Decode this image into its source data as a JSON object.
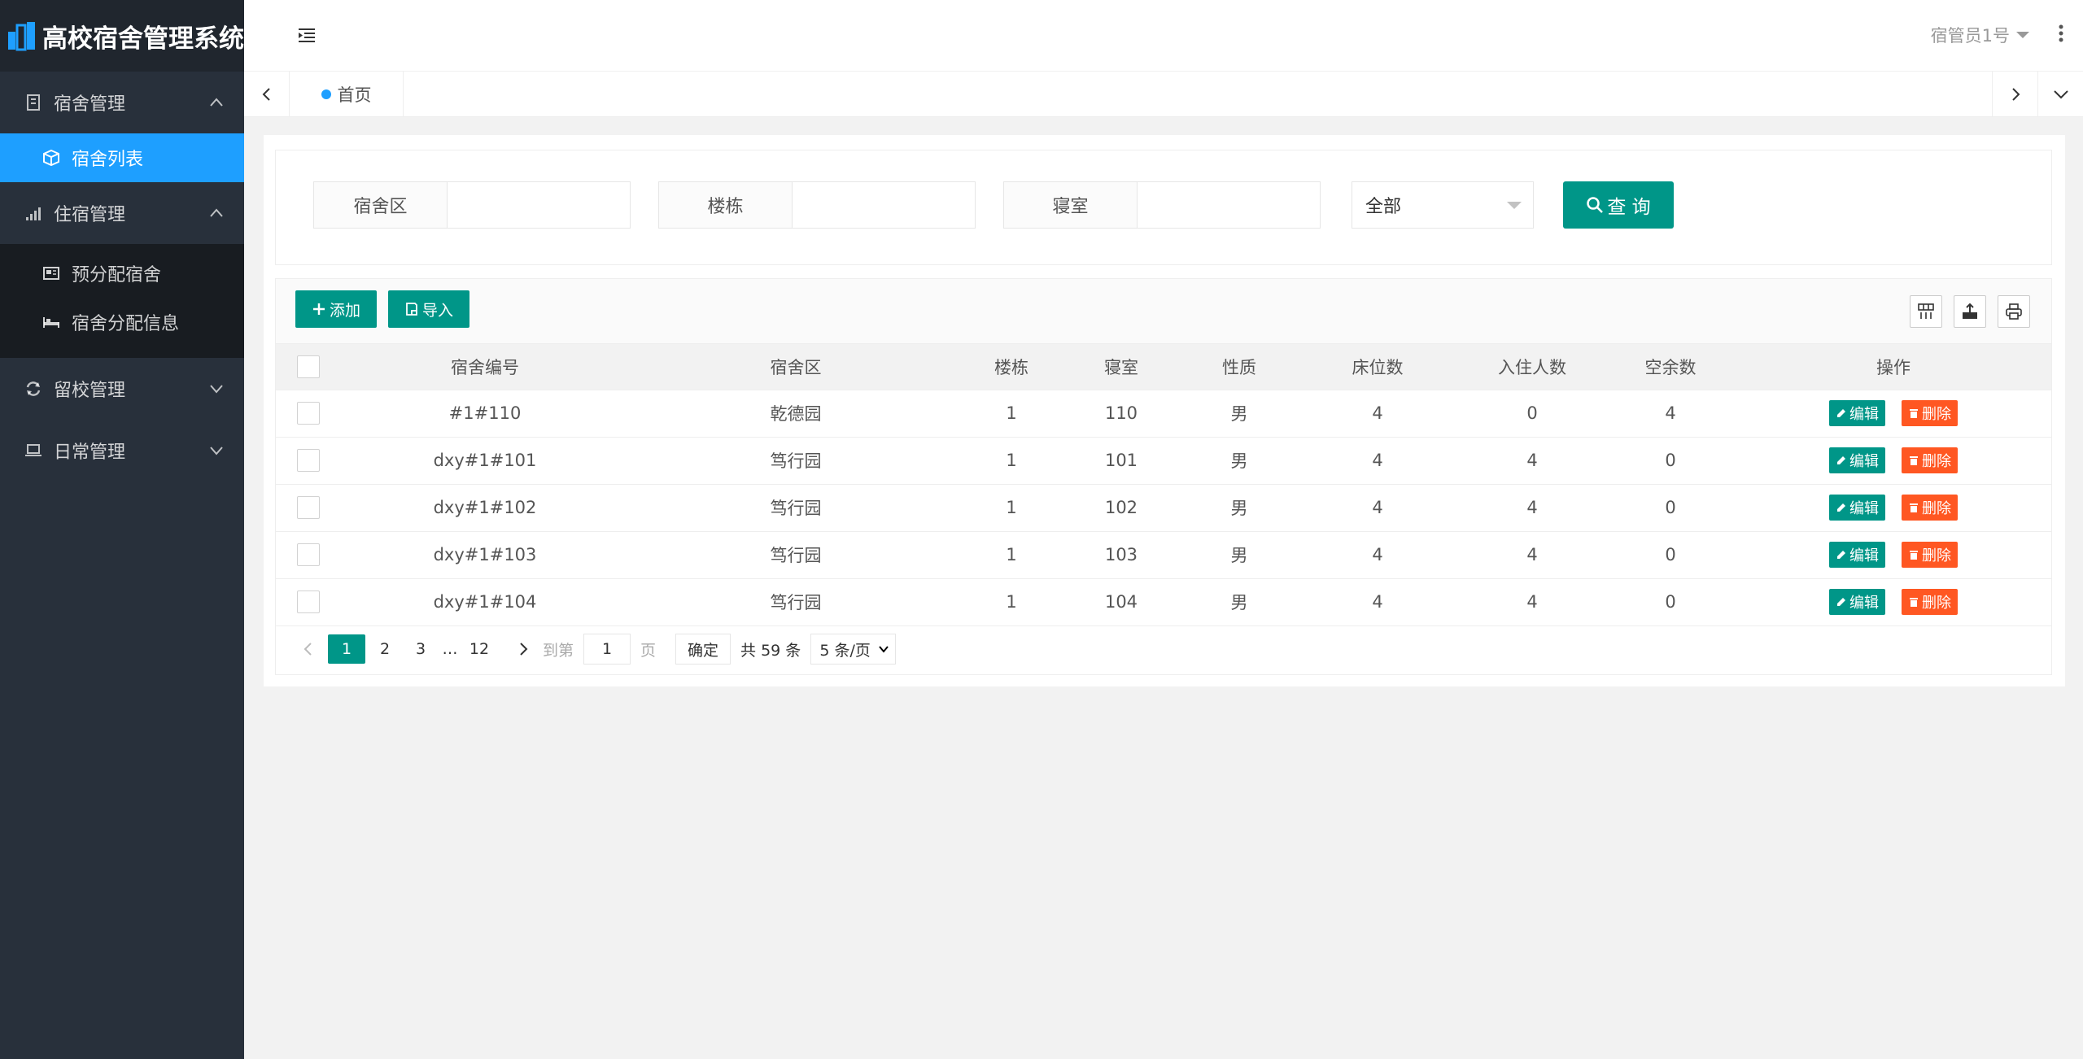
{
  "app": {
    "title": "高校宿舍管理系统"
  },
  "sidebar": {
    "groups": [
      {
        "label": "宿舍管理",
        "items": [
          "宿舍列表"
        ]
      },
      {
        "label": "住宿管理",
        "items": [
          "预分配宿舍",
          "宿舍分配信息"
        ]
      },
      {
        "label": "留校管理"
      },
      {
        "label": "日常管理"
      }
    ]
  },
  "header": {
    "user": "宿管员1号"
  },
  "tabs": {
    "home": "首页"
  },
  "search": {
    "area_label": "宿舍区",
    "building_label": "楼栋",
    "room_label": "寝室",
    "select_value": "全部",
    "query_label": "查 询"
  },
  "toolbar": {
    "add_label": "添加",
    "import_label": "导入"
  },
  "table": {
    "columns": [
      "宿舍编号",
      "宿舍区",
      "楼栋",
      "寝室",
      "性质",
      "床位数",
      "入住人数",
      "空余数",
      "操作"
    ],
    "rows": [
      [
        "#1#110",
        "乾德园",
        "1",
        "110",
        "男",
        "4",
        "0",
        "4"
      ],
      [
        "dxy#1#101",
        "笃行园",
        "1",
        "101",
        "男",
        "4",
        "4",
        "0"
      ],
      [
        "dxy#1#102",
        "笃行园",
        "1",
        "102",
        "男",
        "4",
        "4",
        "0"
      ],
      [
        "dxy#1#103",
        "笃行园",
        "1",
        "103",
        "男",
        "4",
        "4",
        "0"
      ],
      [
        "dxy#1#104",
        "笃行园",
        "1",
        "104",
        "男",
        "4",
        "4",
        "0"
      ]
    ],
    "edit_label": "编辑",
    "delete_label": "删除"
  },
  "pager": {
    "pages": [
      "1",
      "2",
      "3",
      "…",
      "12"
    ],
    "goto_label": "到第",
    "goto_value": "1",
    "page_unit": "页",
    "ok_label": "确定",
    "total": "共 59 条",
    "page_size": "5 条/页"
  },
  "colors": {
    "primary": "#009688",
    "danger": "#ff5722",
    "accent": "#1e9fff",
    "sidebar": "#28303b"
  }
}
